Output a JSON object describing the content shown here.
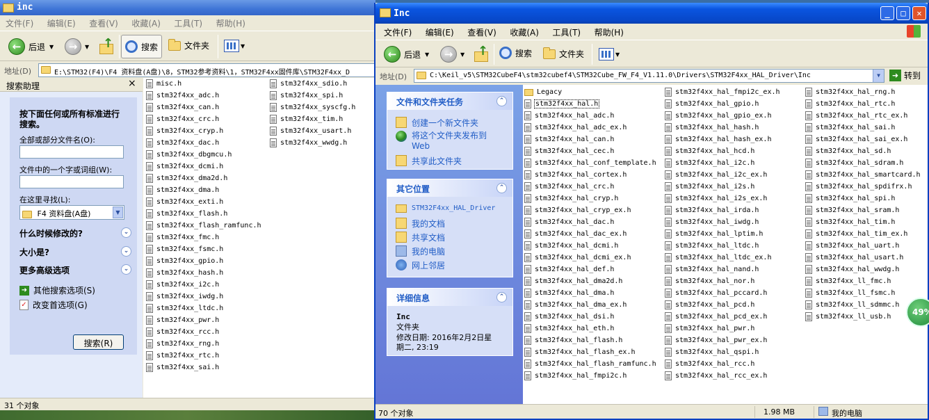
{
  "left_window": {
    "title": "inc",
    "menu": [
      "文件(F)",
      "编辑(E)",
      "查看(V)",
      "收藏(A)",
      "工具(T)",
      "帮助(H)"
    ],
    "toolbar": {
      "back": "后退",
      "search": "搜索",
      "folders": "文件夹"
    },
    "address_label": "地址(D)",
    "address": "E:\\STM32(F4)\\F4 资料盘(A盘)\\8，STM32参考资料\\1，STM32F4xx固件库\\STM32F4xx_D",
    "search_companion": {
      "title": "搜索助理",
      "close": "×",
      "heading": "按下面任何或所有标准进行搜索。",
      "filename_label": "全部或部分文件名(O):",
      "text_label": "文件中的一个字或词组(W):",
      "lookin_label": "在这里寻找(L):",
      "lookin_value": "F4 资料盘(A盘)",
      "when_modified": "什么时候修改的?",
      "size": "大小是?",
      "advanced": "更多高级选项",
      "other_options": "其他搜索选项(S)",
      "change_prefs": "改变首选项(G)",
      "search_button": "搜索(R)"
    },
    "files_col1": [
      "misc.h",
      "stm32f4xx_adc.h",
      "stm32f4xx_can.h",
      "stm32f4xx_crc.h",
      "stm32f4xx_cryp.h",
      "stm32f4xx_dac.h",
      "stm32f4xx_dbgmcu.h",
      "stm32f4xx_dcmi.h",
      "stm32f4xx_dma2d.h",
      "stm32f4xx_dma.h",
      "stm32f4xx_exti.h",
      "stm32f4xx_flash.h",
      "stm32f4xx_flash_ramfunc.h",
      "stm32f4xx_fmc.h",
      "stm32f4xx_fsmc.h",
      "stm32f4xx_gpio.h",
      "stm32f4xx_hash.h",
      "stm32f4xx_i2c.h",
      "stm32f4xx_iwdg.h",
      "stm32f4xx_ltdc.h",
      "stm32f4xx_pwr.h",
      "stm32f4xx_rcc.h",
      "stm32f4xx_rng.h",
      "stm32f4xx_rtc.h",
      "stm32f4xx_sai.h"
    ],
    "files_col2": [
      "stm32f4xx_sdio.h",
      "stm32f4xx_spi.h",
      "stm32f4xx_syscfg.h",
      "stm32f4xx_tim.h",
      "stm32f4xx_usart.h",
      "stm32f4xx_wwdg.h"
    ],
    "status": "31 个对象"
  },
  "right_window": {
    "title": "Inc",
    "menu": [
      "文件(F)",
      "编辑(E)",
      "查看(V)",
      "收藏(A)",
      "工具(T)",
      "帮助(H)"
    ],
    "toolbar": {
      "back": "后退",
      "search": "搜索",
      "folders": "文件夹"
    },
    "address_label": "地址(D)",
    "address": "C:\\Keil_v5\\STM32CubeF4\\stm32cubef4\\STM32Cube_FW_F4_V1.11.0\\Drivers\\STM32F4xx_HAL_Driver\\Inc",
    "go": "转到",
    "tasks": {
      "title": "文件和文件夹任务",
      "items": [
        "创建一个新文件夹",
        "将这个文件夹发布到 Web",
        "共享此文件夹"
      ]
    },
    "places": {
      "title": "其它位置",
      "items": [
        "STM32F4xx_HAL_Driver",
        "我的文档",
        "共享文档",
        "我的电脑",
        "网上邻居"
      ]
    },
    "details": {
      "title": "详细信息",
      "name": "Inc",
      "type": "文件夹",
      "modified_line1": "修改日期: 2016年2月2日星",
      "modified_line2": "期二, 23:19"
    },
    "files_col1": [
      "Legacy",
      "stm32f4xx_hal.h",
      "stm32f4xx_hal_adc.h",
      "stm32f4xx_hal_adc_ex.h",
      "stm32f4xx_hal_can.h",
      "stm32f4xx_hal_cec.h",
      "stm32f4xx_hal_conf_template.h",
      "stm32f4xx_hal_cortex.h",
      "stm32f4xx_hal_crc.h",
      "stm32f4xx_hal_cryp.h",
      "stm32f4xx_hal_cryp_ex.h",
      "stm32f4xx_hal_dac.h",
      "stm32f4xx_hal_dac_ex.h",
      "stm32f4xx_hal_dcmi.h",
      "stm32f4xx_hal_dcmi_ex.h",
      "stm32f4xx_hal_def.h",
      "stm32f4xx_hal_dma2d.h",
      "stm32f4xx_hal_dma.h",
      "stm32f4xx_hal_dma_ex.h",
      "stm32f4xx_hal_dsi.h",
      "stm32f4xx_hal_eth.h",
      "stm32f4xx_hal_flash.h",
      "stm32f4xx_hal_flash_ex.h",
      "stm32f4xx_hal_flash_ramfunc.h",
      "stm32f4xx_hal_fmpi2c.h"
    ],
    "files_col2": [
      "stm32f4xx_hal_fmpi2c_ex.h",
      "stm32f4xx_hal_gpio.h",
      "stm32f4xx_hal_gpio_ex.h",
      "stm32f4xx_hal_hash.h",
      "stm32f4xx_hal_hash_ex.h",
      "stm32f4xx_hal_hcd.h",
      "stm32f4xx_hal_i2c.h",
      "stm32f4xx_hal_i2c_ex.h",
      "stm32f4xx_hal_i2s.h",
      "stm32f4xx_hal_i2s_ex.h",
      "stm32f4xx_hal_irda.h",
      "stm32f4xx_hal_iwdg.h",
      "stm32f4xx_hal_lptim.h",
      "stm32f4xx_hal_ltdc.h",
      "stm32f4xx_hal_ltdc_ex.h",
      "stm32f4xx_hal_nand.h",
      "stm32f4xx_hal_nor.h",
      "stm32f4xx_hal_pccard.h",
      "stm32f4xx_hal_pcd.h",
      "stm32f4xx_hal_pcd_ex.h",
      "stm32f4xx_hal_pwr.h",
      "stm32f4xx_hal_pwr_ex.h",
      "stm32f4xx_hal_qspi.h",
      "stm32f4xx_hal_rcc.h",
      "stm32f4xx_hal_rcc_ex.h"
    ],
    "files_col3": [
      "stm32f4xx_hal_rng.h",
      "stm32f4xx_hal_rtc.h",
      "stm32f4xx_hal_rtc_ex.h",
      "stm32f4xx_hal_sai.h",
      "stm32f4xx_hal_sai_ex.h",
      "stm32f4xx_hal_sd.h",
      "stm32f4xx_hal_sdram.h",
      "stm32f4xx_hal_smartcard.h",
      "stm32f4xx_hal_spdifrx.h",
      "stm32f4xx_hal_spi.h",
      "stm32f4xx_hal_sram.h",
      "stm32f4xx_hal_tim.h",
      "stm32f4xx_hal_tim_ex.h",
      "stm32f4xx_hal_uart.h",
      "stm32f4xx_hal_usart.h",
      "stm32f4xx_hal_wwdg.h",
      "stm32f4xx_ll_fmc.h",
      "stm32f4xx_ll_fsmc.h",
      "stm32f4xx_ll_sdmmc.h",
      "stm32f4xx_ll_usb.h"
    ],
    "status_count": "70 个对象",
    "status_size": "1.98 MB",
    "status_location": "我的电脑"
  },
  "badge": "49%",
  "colors": {
    "title_blue": "#0a55e0",
    "task_blue": "#215dc6",
    "pane_blue": "#7ba2e7"
  }
}
